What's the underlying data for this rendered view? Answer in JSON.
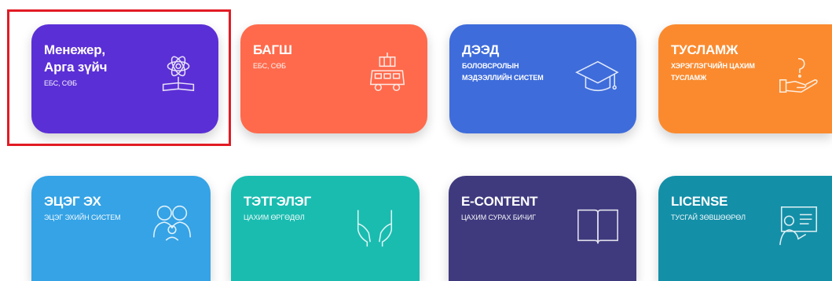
{
  "tiles": [
    {
      "title_line1": "Менежер,",
      "title_line2": "Арга зүйч",
      "subtitle": "ЕБС, СӨБ",
      "color": "#5b2fd6",
      "icon": "atom-book-icon"
    },
    {
      "title_line1": "БАГШ",
      "title_line2": "",
      "subtitle": "ЕБС, СӨБ",
      "color": "#ff6a4c",
      "icon": "school-bus-icon"
    },
    {
      "title_line1": "ДЭЭД",
      "title_line2": "",
      "subtitle_line1": "БОЛОВСРОЛЫН",
      "subtitle_line2": "МЭДЭЭЛЛИЙН СИСТЕМ",
      "color": "#3e6cdb",
      "icon": "graduation-cap-icon"
    },
    {
      "title_line1": "ТУСЛАМЖ",
      "title_line2": "",
      "subtitle_line1": "ХЭРЭГЛЭГЧИЙН ЦАХИМ",
      "subtitle_line2": "ТУСЛАМЖ",
      "color": "#fb8a2e",
      "icon": "help-hand-icon"
    },
    {
      "title_line1": "ЭЦЭГ ЭХ",
      "subtitle": "ЭЦЭГ ЭХИЙН СИСТЕМ",
      "color": "#35a3e6",
      "icon": "parents-icon"
    },
    {
      "title_line1": "ТЭТГЭЛЭГ",
      "subtitle": "ЦАХИМ ӨРГӨДӨЛ",
      "color": "#1abcb0",
      "icon": "open-hands-icon"
    },
    {
      "title_line1": "E-CONTENT",
      "subtitle": "ЦАХИМ СУРАХ БИЧИГ",
      "color": "#3f3a7e",
      "icon": "open-book-icon"
    },
    {
      "title_line1": "LICENSE",
      "subtitle": "ТУСГАЙ ЗӨВШӨӨРӨЛ",
      "color": "#148fa8",
      "icon": "presenter-board-icon"
    }
  ]
}
